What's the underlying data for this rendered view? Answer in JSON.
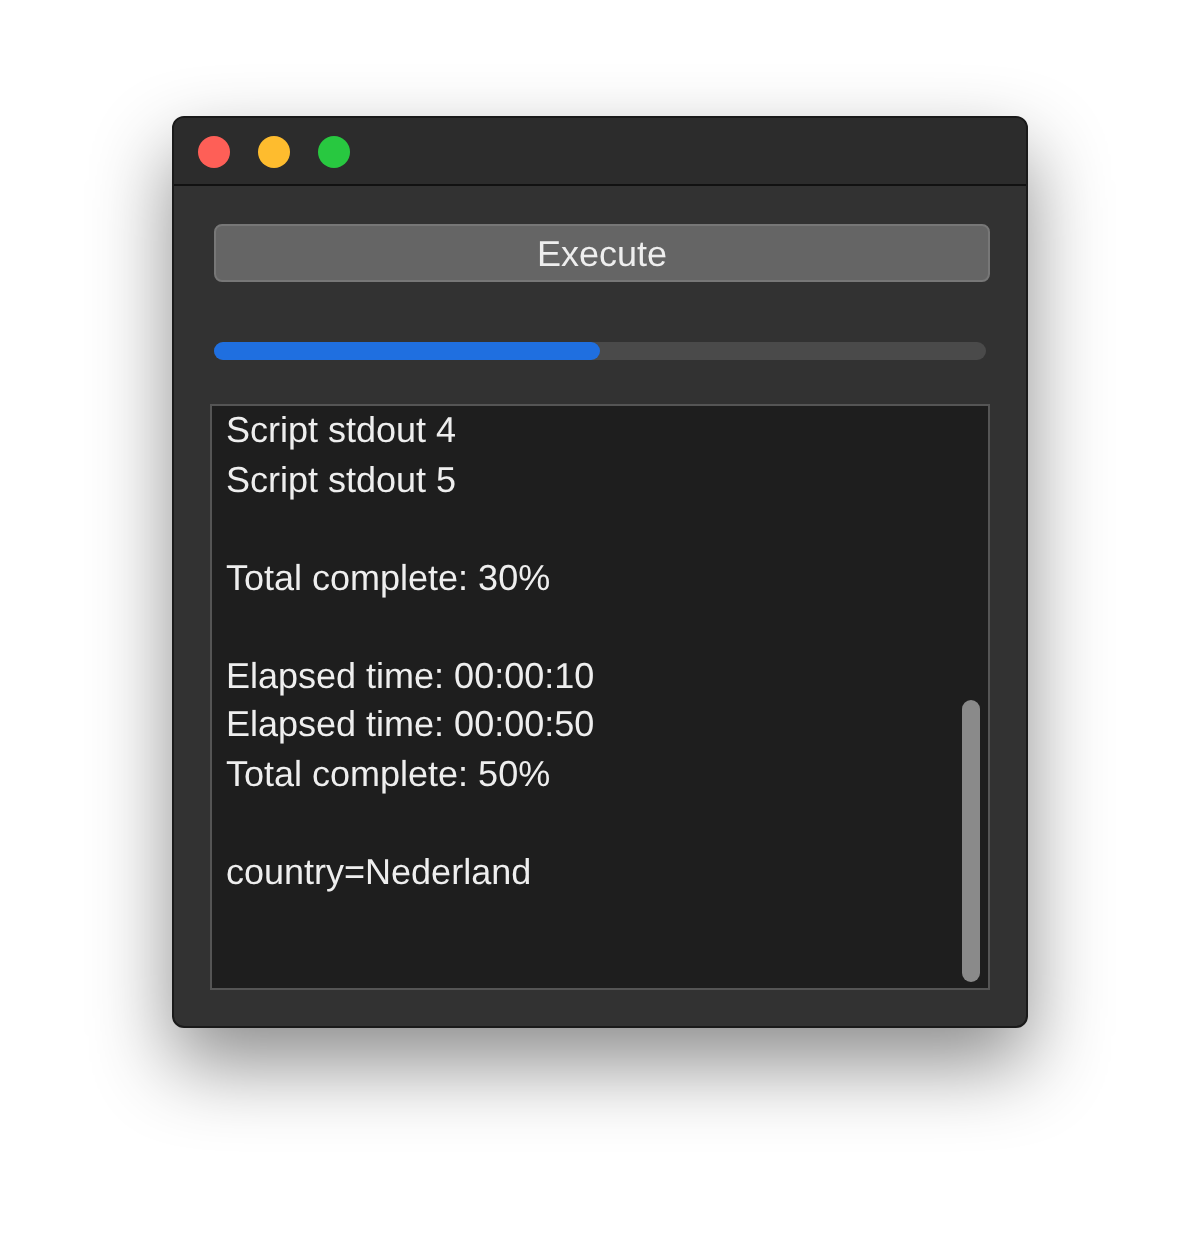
{
  "button": {
    "label": "Execute"
  },
  "progress": {
    "level": 0.5
  },
  "output": {
    "blocks": [
      [
        "Script stdout 4",
        "Script stdout 5"
      ],
      [
        "Total complete: 30%"
      ],
      [
        "Elapsed time: 00:00:10",
        "Elapsed time: 00:00:50",
        "Total complete: 50%"
      ],
      [
        "country=Nederland"
      ]
    ]
  }
}
